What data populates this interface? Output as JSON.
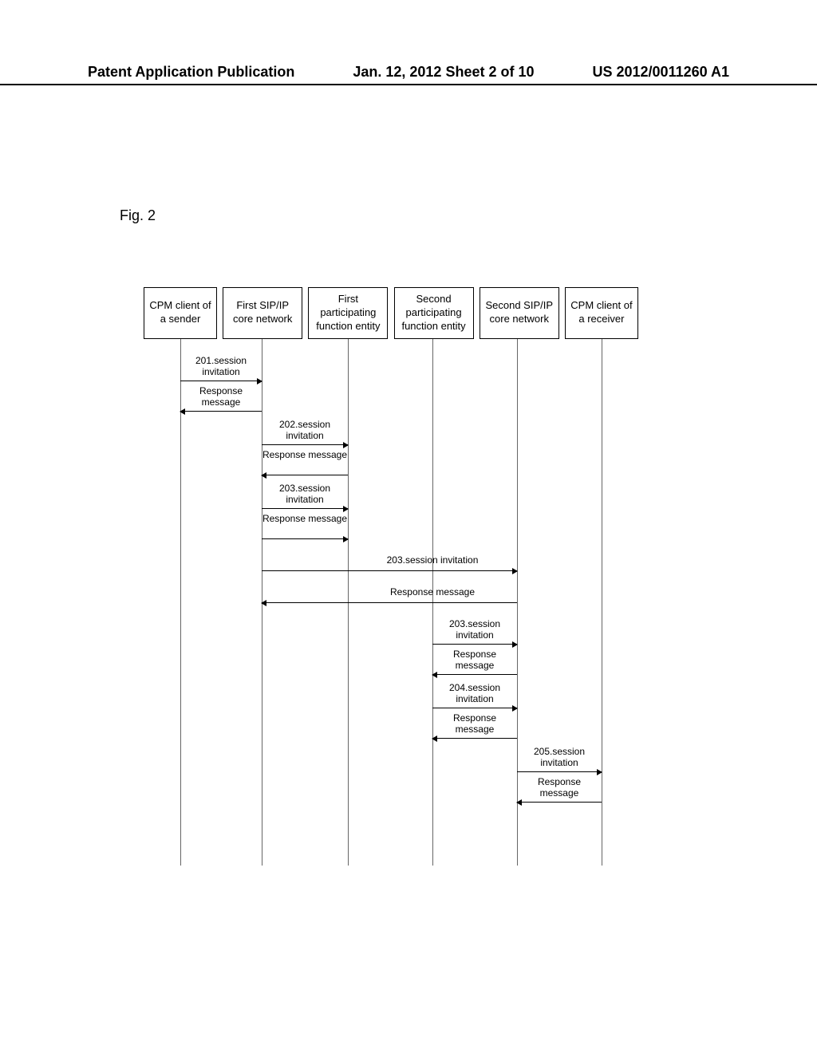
{
  "header": {
    "left": "Patent Application Publication",
    "center": "Jan. 12, 2012  Sheet 2 of 10",
    "right": "US 2012/0011260 A1"
  },
  "figureLabel": "Fig. 2",
  "actors": [
    "CPM client of a sender",
    "First SIP/IP core network",
    "First participating function entity",
    "Second participating function entity",
    "Second SIP/IP core network",
    "CPM client of a receiver"
  ],
  "messages": {
    "m201a": "201.session invitation",
    "m201b": "Response message",
    "m202a": "202.session invitation",
    "m202b": "Response message",
    "m203a": "203.session invitation",
    "m203b": "Response message",
    "m203c": "203.session invitation",
    "m203d": "Response message",
    "m203e": "203.session invitation",
    "m203f": "Response message",
    "m204a": "204.session invitation",
    "m204b": "Response message",
    "m205a": "205.session invitation",
    "m205b": "Response message"
  }
}
